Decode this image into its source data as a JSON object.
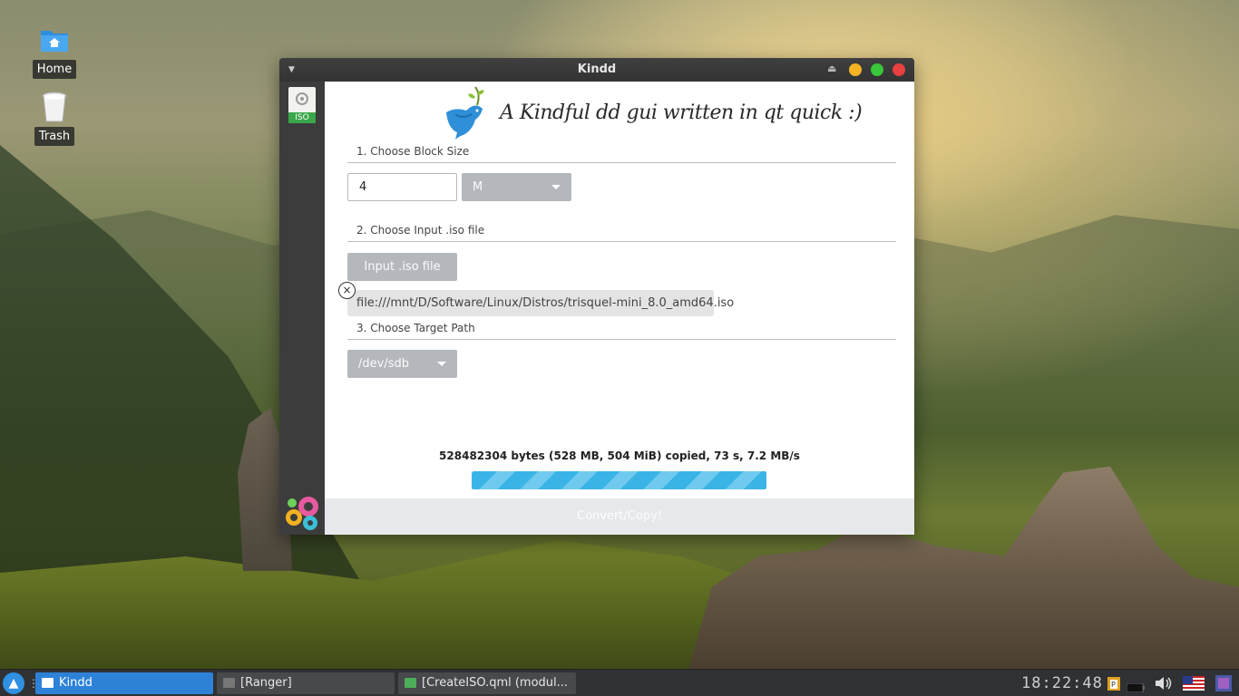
{
  "desktop": {
    "icons": [
      {
        "label": "Home",
        "icon": "home-folder-icon"
      },
      {
        "label": "Trash",
        "icon": "trash-icon"
      }
    ]
  },
  "window": {
    "title": "Kindd",
    "tagline": "A Kindful dd gui written in qt quick :)",
    "sidebar": {
      "iso_tab_label": "ISO"
    },
    "block_size": {
      "section_title": "1. Choose Block Size",
      "value": "4",
      "unit": "M"
    },
    "input_file": {
      "section_title": "2. Choose Input .iso file",
      "button_label": "Input .iso file",
      "clear_glyph": "×",
      "path": "file:///mnt/D/Software/Linux/Distros/trisquel-mini_8.0_amd64.iso"
    },
    "target": {
      "section_title": "3. Choose Target Path",
      "device": "/dev/sdb"
    },
    "status": "528482304 bytes (528 MB, 504 MiB) copied, 73 s, 7.2 MB/s",
    "progress": 1.0,
    "convert_label": "Convert/Copy!"
  },
  "taskbar": {
    "tasks": [
      {
        "label": "Kindd",
        "active": true
      },
      {
        "label": "[Ranger]",
        "active": false
      },
      {
        "label": "[CreateISO.qml (modul...",
        "active": false
      }
    ],
    "clock": "18:22:48",
    "tray_icons": [
      "clipboard-icon",
      "battery-icon",
      "volume-icon",
      "us-flag-icon",
      "screen-icon"
    ]
  },
  "colors": {
    "accent": "#2d82d8",
    "progress": "#3ab4e6",
    "combo_bg": "#b4b8bd"
  }
}
